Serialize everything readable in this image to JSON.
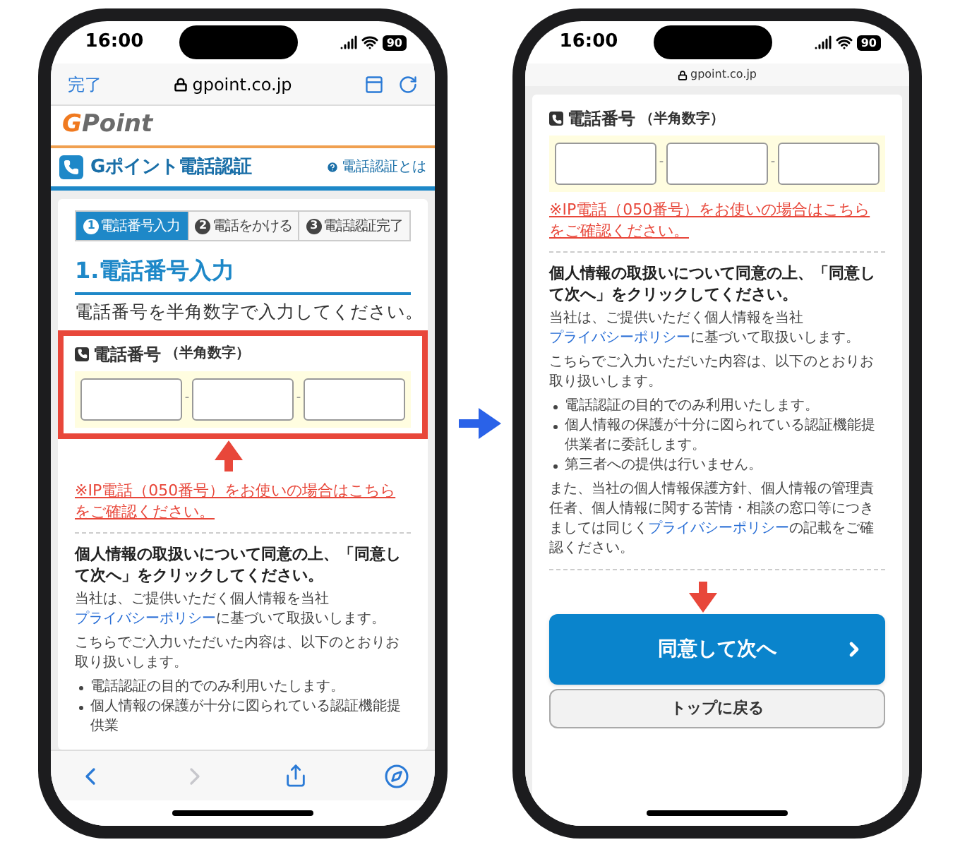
{
  "phones": [
    {
      "status_bar": {
        "time": "16:00",
        "battery": "90"
      },
      "browser": {
        "kind": "full",
        "done": "完了",
        "address": "gpoint.co.jp"
      },
      "header": [
        {
          "kind": "logo_bar",
          "mark": "G",
          "text": "Point"
        },
        {
          "kind": "title_bar",
          "title": "Gポイント電話認証",
          "help": "電話認証とは"
        }
      ],
      "body": [
        {
          "kind": "steps",
          "items": [
            {
              "number": "1",
              "label": "電話番号入力",
              "selected": true
            },
            {
              "number": "2",
              "label": "電話をかける",
              "selected": false
            },
            {
              "number": "3",
              "label": "電話認証完了",
              "selected": false
            }
          ]
        },
        {
          "kind": "heading",
          "text": "1.電話番号入力"
        },
        {
          "kind": "instruction",
          "text": "電話番号を半角数字で入力してください。"
        },
        {
          "kind": "phone_field",
          "label": "電話番号",
          "note": "（半角数字）",
          "highlighted": true,
          "parts": [
            {
              "kind": "input"
            },
            {
              "kind": "separator",
              "text": "-"
            },
            {
              "kind": "input"
            },
            {
              "kind": "separator",
              "text": "-"
            },
            {
              "kind": "input"
            }
          ]
        },
        {
          "kind": "ip_notice",
          "text": "※IP電話（050番号）をお使いの場合はこちらをご確認ください。"
        },
        {
          "kind": "divider"
        },
        {
          "kind": "consent",
          "text": "個人情報の取扱いについて同意の上、「同意して次へ」をクリックしてください。"
        },
        {
          "kind": "paragraph",
          "segments": [
            {
              "kind": "text",
              "text": "当社は、ご提供いただく個人情報を当社"
            },
            {
              "kind": "link",
              "text": "プライバシーポリシー"
            },
            {
              "kind": "text",
              "text": "に基づいて取扱いします。"
            }
          ]
        },
        {
          "kind": "paragraph",
          "segments": [
            {
              "kind": "text",
              "text": "こちらでご入力いただいた内容は、以下のとおりお取り扱いします。"
            }
          ]
        },
        {
          "kind": "bullets",
          "items": [
            "電話認証の目的でのみ利用いたします。",
            "個人情報の保護が十分に図られている認証機能提供業"
          ]
        }
      ],
      "toolbar": [
        {
          "kind": "back",
          "disabled": false
        },
        {
          "kind": "forward",
          "disabled": true
        },
        {
          "kind": "share",
          "disabled": false
        },
        {
          "kind": "compass",
          "disabled": false
        }
      ]
    },
    {
      "status_bar": {
        "time": "16:00",
        "battery": "90"
      },
      "browser": {
        "kind": "compact",
        "address": "gpoint.co.jp"
      },
      "body": [
        {
          "kind": "phone_field",
          "label": "電話番号",
          "note": "（半角数字）",
          "highlighted": false,
          "parts": [
            {
              "kind": "input"
            },
            {
              "kind": "separator",
              "text": "-"
            },
            {
              "kind": "input"
            },
            {
              "kind": "separator",
              "text": "-"
            },
            {
              "kind": "input"
            }
          ]
        },
        {
          "kind": "ip_notice",
          "text": "※IP電話（050番号）をお使いの場合はこちらをご確認ください。"
        },
        {
          "kind": "divider"
        },
        {
          "kind": "consent",
          "text": "個人情報の取扱いについて同意の上、「同意して次へ」をクリックしてください。"
        },
        {
          "kind": "paragraph",
          "segments": [
            {
              "kind": "text",
              "text": "当社は、ご提供いただく個人情報を当社"
            },
            {
              "kind": "link",
              "text": "プライバシーポリシー"
            },
            {
              "kind": "text",
              "text": "に基づいて取扱いします。"
            }
          ]
        },
        {
          "kind": "paragraph",
          "segments": [
            {
              "kind": "text",
              "text": "こちらでご入力いただいた内容は、以下のとおりお取り扱いします。"
            }
          ]
        },
        {
          "kind": "bullets",
          "items": [
            "電話認証の目的でのみ利用いたします。",
            "個人情報の保護が十分に図られている認証機能提供業者に委託します。",
            "第三者への提供は行いません。"
          ]
        },
        {
          "kind": "paragraph",
          "segments": [
            {
              "kind": "text",
              "text": "また、当社の個人情報保護方針、個人情報の管理責任者、個人情報に関する苦情・相談の窓口等につきましては同じく"
            },
            {
              "kind": "link",
              "text": "プライバシーポリシー"
            },
            {
              "kind": "text",
              "text": "の記載をご確認ください。"
            }
          ]
        },
        {
          "kind": "divider"
        },
        {
          "kind": "primary_button",
          "text": "同意して次へ",
          "pointed": true
        },
        {
          "kind": "secondary_button",
          "text": "トップに戻る"
        }
      ]
    }
  ]
}
